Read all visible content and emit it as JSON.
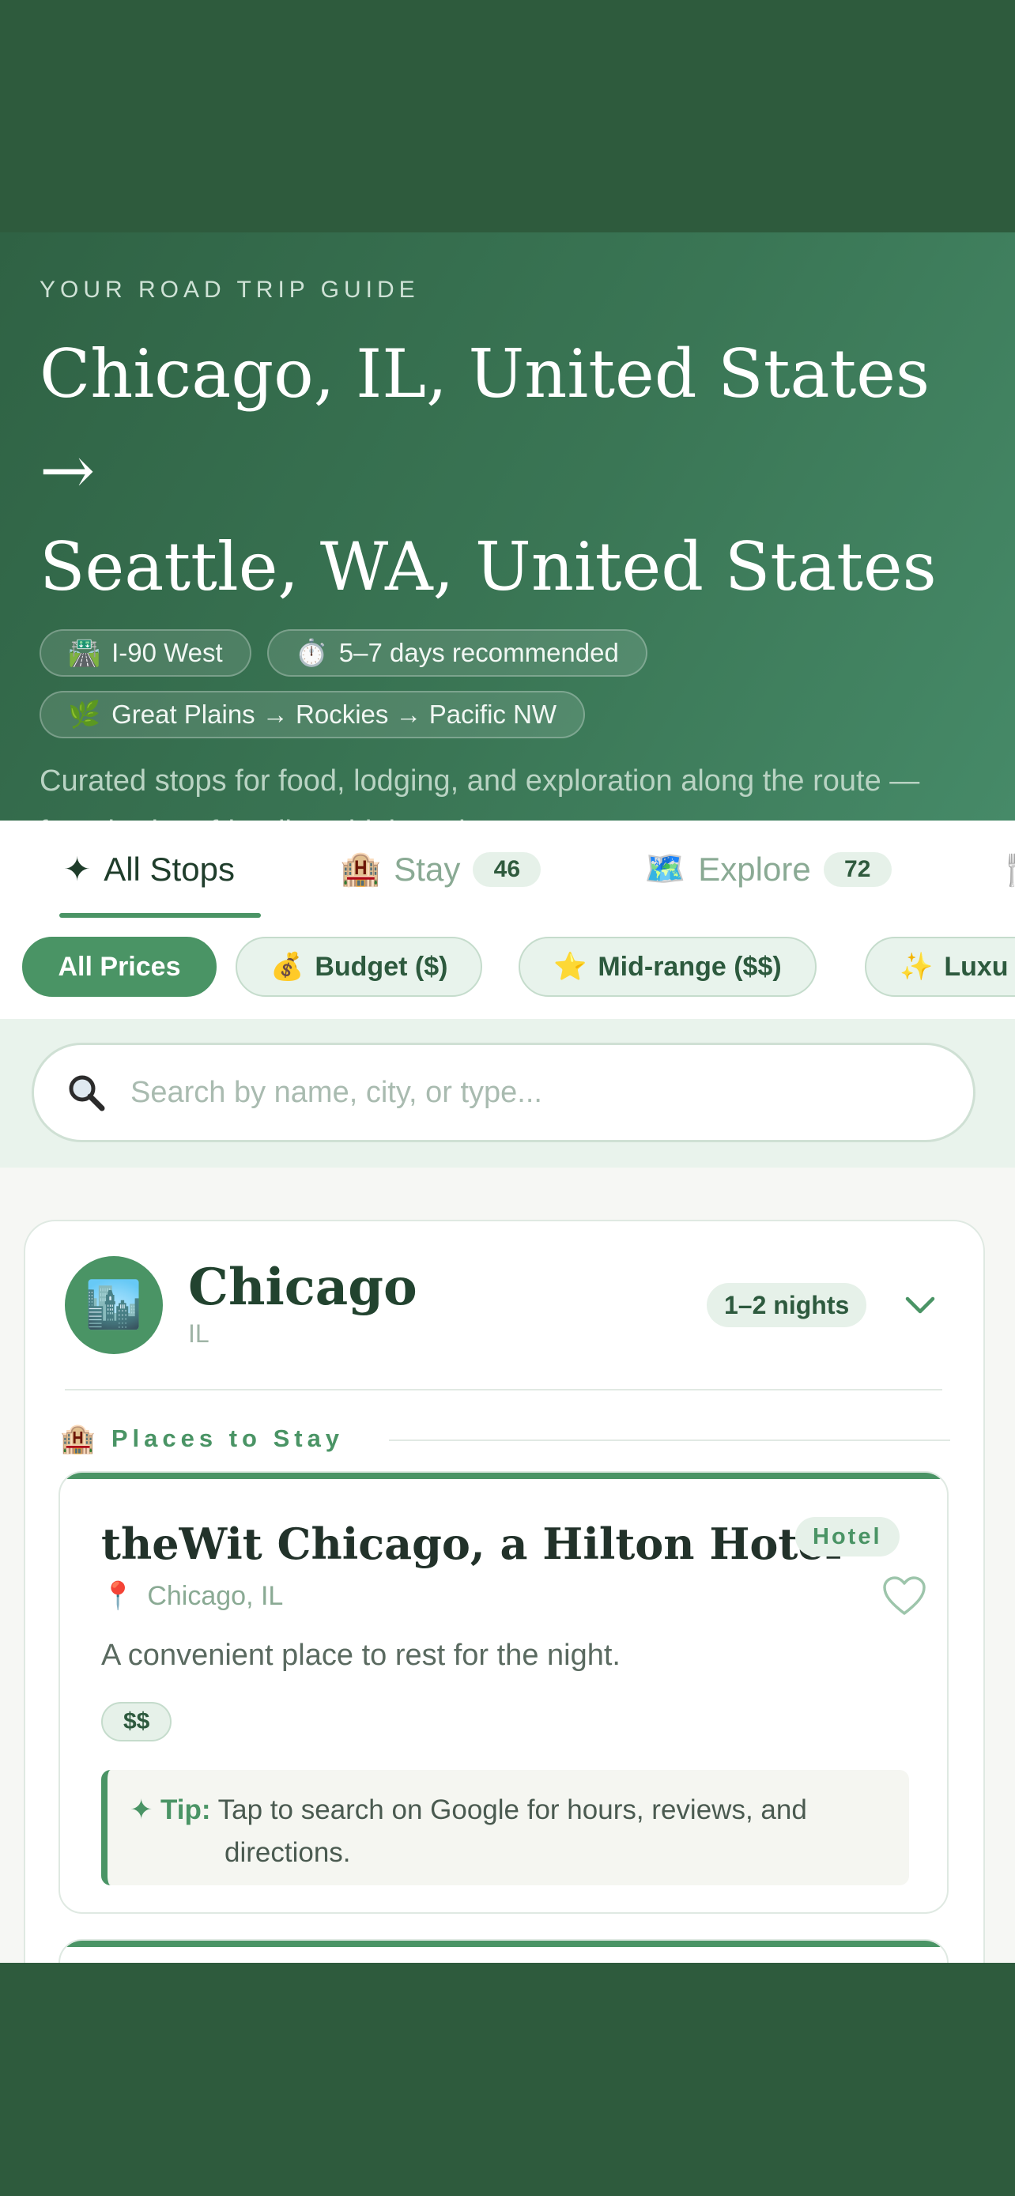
{
  "hero": {
    "kicker": "YOUR ROAD TRIP GUIDE",
    "title_line1": "Chicago, IL, United States →",
    "title_line2": "Seattle, WA, United States",
    "chips": [
      {
        "icon": "🛣️",
        "label": "I-90 West"
      },
      {
        "icon": "⏱️",
        "label": "5–7 days recommended"
      },
      {
        "icon": "🌿",
        "label": "Great Plains → Rockies → Pacific NW"
      }
    ],
    "description": "Curated stops for food, lodging, and exploration along the route — from budget-friendly to high-end."
  },
  "tabs": [
    {
      "icon": "✦",
      "label": "All Stops",
      "active": true
    },
    {
      "icon": "🏨",
      "label": "Stay",
      "count": "46"
    },
    {
      "icon": "🗺️",
      "label": "Explore",
      "count": "72"
    },
    {
      "icon": "🍴",
      "label": ""
    }
  ],
  "price_filters": [
    {
      "icon": "",
      "label": "All Prices",
      "active": true
    },
    {
      "icon": "💰",
      "label": "Budget ($)"
    },
    {
      "icon": "⭐",
      "label": "Mid-range ($$)"
    },
    {
      "icon": "✨",
      "label": "Luxu"
    }
  ],
  "search": {
    "placeholder": "Search by name, city, or type..."
  },
  "city": {
    "icon": "🏙️",
    "name": "Chicago",
    "state": "IL",
    "nights": "1–2 nights",
    "section_icon": "🏨",
    "section_label": "Places to Stay"
  },
  "place": {
    "name": "theWit Chicago, a Hilton Hotel",
    "type": "Hotel",
    "location_icon": "📍",
    "location": "Chicago, IL",
    "description": "A convenient place to rest for the night.",
    "price": "$$",
    "tip_label": "✦ Tip:",
    "tip_text": "Tap to search on Google for hours, reviews, and directions."
  },
  "colors": {
    "frame": "#2e5b3d",
    "accent": "#4a9465",
    "dark_text": "#22432f"
  }
}
